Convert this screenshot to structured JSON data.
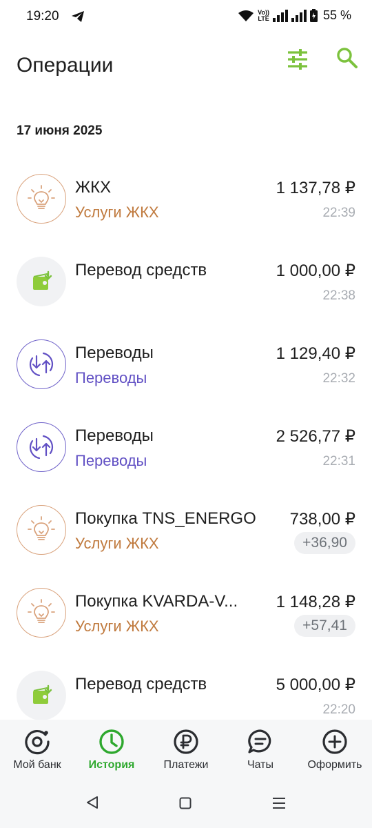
{
  "status_bar": {
    "time": "19:20",
    "volte_top": "Vo))",
    "volte_bottom": "LTE",
    "battery": "55 %"
  },
  "header": {
    "title": "Операции",
    "filter_icon": "sliders-icon",
    "search_icon": "search-icon"
  },
  "date_group": "17 июня 2025",
  "operations": [
    {
      "title": "ЖКХ",
      "category": "Услуги ЖКХ",
      "amount": "1 137,78 ₽",
      "time": "22:39",
      "bonus": "",
      "icon": "lightbulb-icon"
    },
    {
      "title": "Перевод средств",
      "category": "",
      "amount": "1 000,00 ₽",
      "time": "22:38",
      "bonus": "",
      "icon": "wallet-transfer-icon"
    },
    {
      "title": "Переводы",
      "category": "Переводы",
      "amount": "1 129,40 ₽",
      "time": "22:32",
      "bonus": "",
      "icon": "transfer-arrows-icon"
    },
    {
      "title": "Переводы",
      "category": "Переводы",
      "amount": "2 526,77 ₽",
      "time": "22:31",
      "bonus": "",
      "icon": "transfer-arrows-icon"
    },
    {
      "title": "Покупка TNS_ENERGO",
      "category": "Услуги ЖКХ",
      "amount": "738,00 ₽",
      "time": "",
      "bonus": "+36,90",
      "icon": "lightbulb-icon"
    },
    {
      "title": "Покупка KVARDA-V...",
      "category": "Услуги ЖКХ",
      "amount": "1 148,28 ₽",
      "time": "",
      "bonus": "+57,41",
      "icon": "lightbulb-icon"
    },
    {
      "title": "Перевод средств",
      "category": "",
      "amount": "5 000,00 ₽",
      "time": "22:20",
      "bonus": "",
      "icon": "wallet-transfer-icon"
    }
  ],
  "bottom_nav": [
    {
      "label": "Мой банк",
      "icon": "my-bank-icon",
      "active": false
    },
    {
      "label": "История",
      "icon": "clock-icon",
      "active": true
    },
    {
      "label": "Платежи",
      "icon": "ruble-icon",
      "active": false
    },
    {
      "label": "Чаты",
      "icon": "chat-icon",
      "active": false
    },
    {
      "label": "Оформить",
      "icon": "plus-circle-icon",
      "active": false
    }
  ],
  "colors": {
    "accent_green": "#2ea82e",
    "icon_green": "#7cc23d",
    "utilities_orange": "#c07a3e",
    "transfers_purple": "#6150c4",
    "time_gray": "#a8acb2"
  }
}
